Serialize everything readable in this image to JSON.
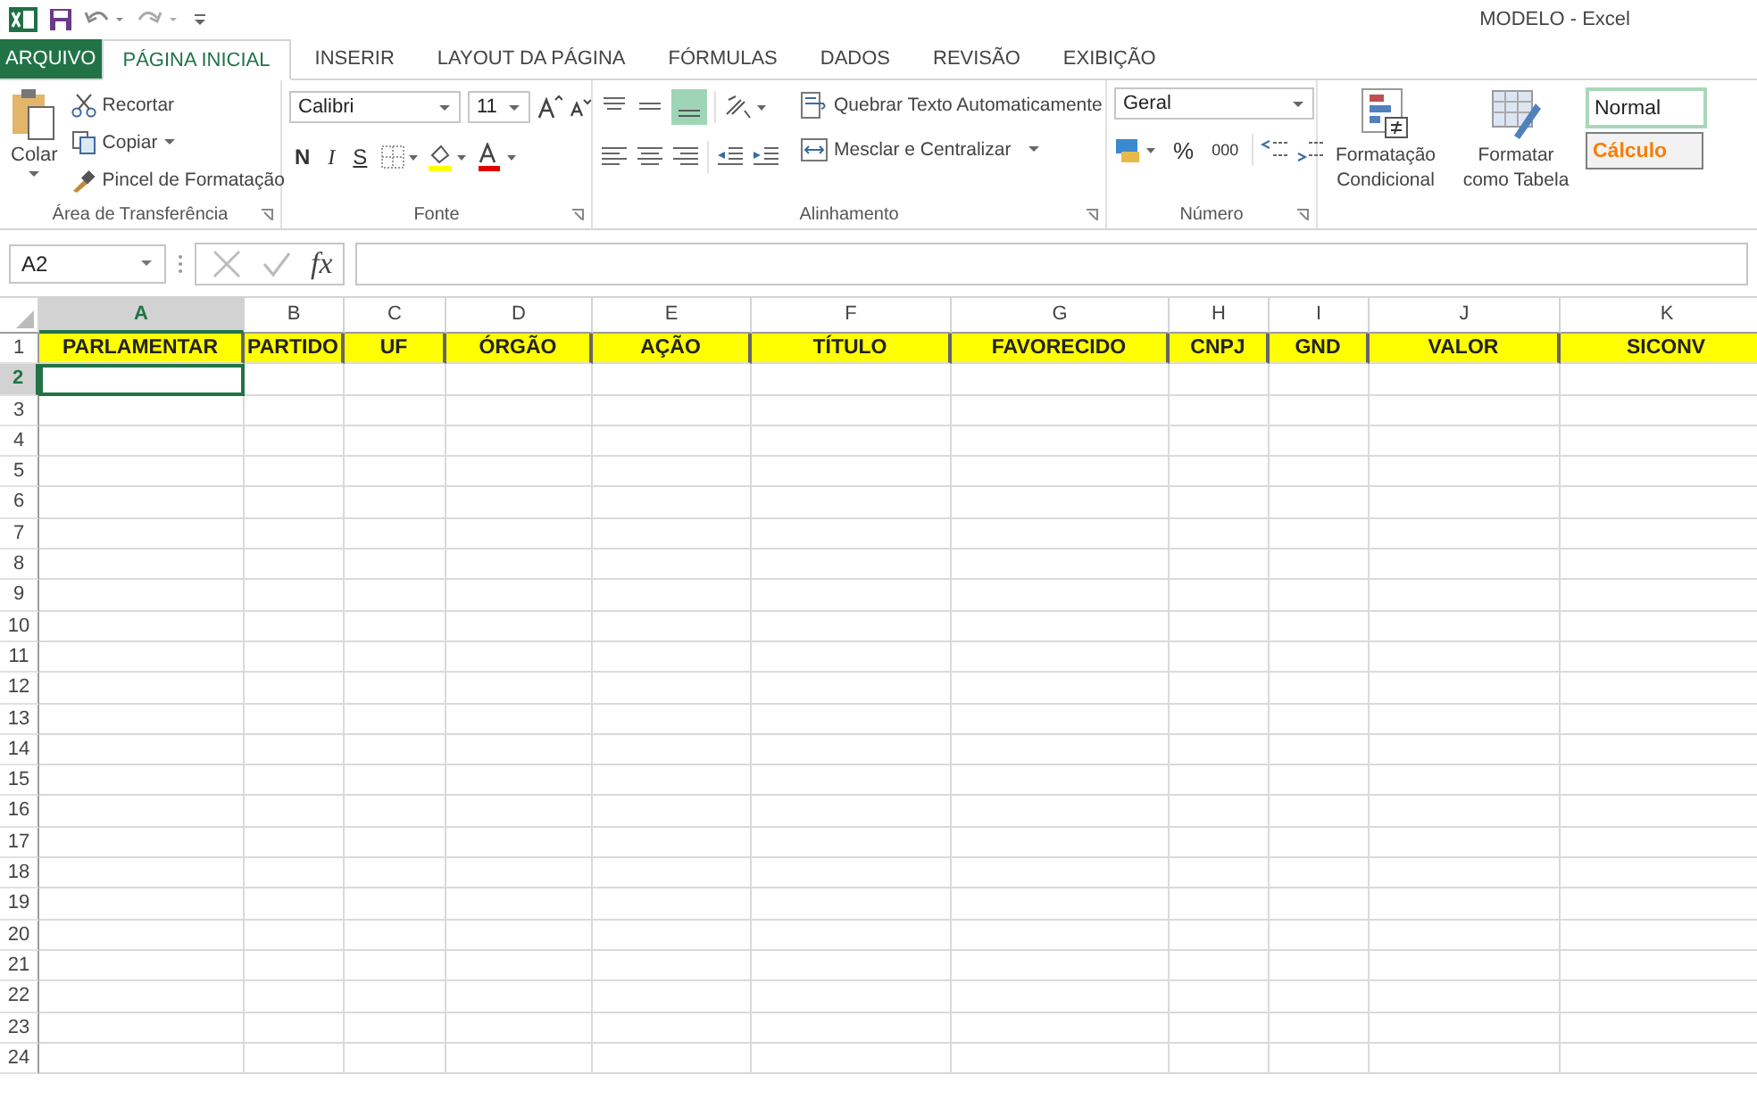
{
  "title": "MODELO - Excel",
  "tabs": [
    {
      "label": "ARQUIVO",
      "kind": "file",
      "selected": false
    },
    {
      "label": "PÁGINA INICIAL",
      "kind": "tab",
      "selected": true
    },
    {
      "label": "INSERIR",
      "kind": "tab",
      "selected": false
    },
    {
      "label": "LAYOUT DA PÁGINA",
      "kind": "tab",
      "selected": false
    },
    {
      "label": "FÓRMULAS",
      "kind": "tab",
      "selected": false
    },
    {
      "label": "DADOS",
      "kind": "tab",
      "selected": false
    },
    {
      "label": "REVISÃO",
      "kind": "tab",
      "selected": false
    },
    {
      "label": "EXIBIÇÃO",
      "kind": "tab",
      "selected": false
    }
  ],
  "clipboard": {
    "paste": "Colar",
    "cut": "Recortar",
    "copy": "Copiar",
    "painter": "Pincel de Formatação",
    "label": "Área de Transferência"
  },
  "font": {
    "name": "Calibri",
    "size": "11",
    "bold": "N",
    "italic": "I",
    "underline": "S",
    "label": "Fonte"
  },
  "alignment": {
    "wrap": "Quebrar Texto Automaticamente",
    "merge": "Mesclar e Centralizar",
    "label": "Alinhamento"
  },
  "number": {
    "format": "Geral",
    "percent": "%",
    "thousands": "000",
    "label": "Número"
  },
  "styles": {
    "conditional": "Formatação Condicional",
    "table": "Formatar como Tabela",
    "normal": "Normal",
    "calc": "Cálculo"
  },
  "formula_bar": {
    "name_box": "A2",
    "fx": "fx"
  },
  "columns": [
    {
      "letter": "A",
      "header": "PARLAMENTAR",
      "selected": true
    },
    {
      "letter": "B",
      "header": "PARTIDO",
      "selected": false
    },
    {
      "letter": "C",
      "header": "UF",
      "selected": false
    },
    {
      "letter": "D",
      "header": "ÓRGÃO",
      "selected": false
    },
    {
      "letter": "E",
      "header": "AÇÃO",
      "selected": false
    },
    {
      "letter": "F",
      "header": "TÍTULO",
      "selected": false
    },
    {
      "letter": "G",
      "header": "FAVORECIDO",
      "selected": false
    },
    {
      "letter": "H",
      "header": "CNPJ",
      "selected": false
    },
    {
      "letter": "I",
      "header": "GND",
      "selected": false
    },
    {
      "letter": "J",
      "header": "VALOR",
      "selected": false
    },
    {
      "letter": "K",
      "header": "SICONV",
      "selected": false
    }
  ],
  "rows": [
    {
      "label": "1",
      "selected": false
    },
    {
      "label": "2",
      "selected": true
    },
    {
      "label": "3",
      "selected": false
    },
    {
      "label": "4",
      "selected": false
    },
    {
      "label": "5",
      "selected": false
    },
    {
      "label": "6",
      "selected": false
    },
    {
      "label": "7",
      "selected": false
    },
    {
      "label": "8",
      "selected": false
    },
    {
      "label": "9",
      "selected": false
    },
    {
      "label": "10",
      "selected": false
    },
    {
      "label": "11",
      "selected": false
    },
    {
      "label": "12",
      "selected": false
    },
    {
      "label": "13",
      "selected": false
    },
    {
      "label": "14",
      "selected": false
    },
    {
      "label": "15",
      "selected": false
    },
    {
      "label": "16",
      "selected": false
    },
    {
      "label": "17",
      "selected": false
    },
    {
      "label": "18",
      "selected": false
    },
    {
      "label": "19",
      "selected": false
    },
    {
      "label": "20",
      "selected": false
    },
    {
      "label": "21",
      "selected": false
    },
    {
      "label": "22",
      "selected": false
    },
    {
      "label": "23",
      "selected": false
    },
    {
      "label": "24",
      "selected": false
    }
  ]
}
